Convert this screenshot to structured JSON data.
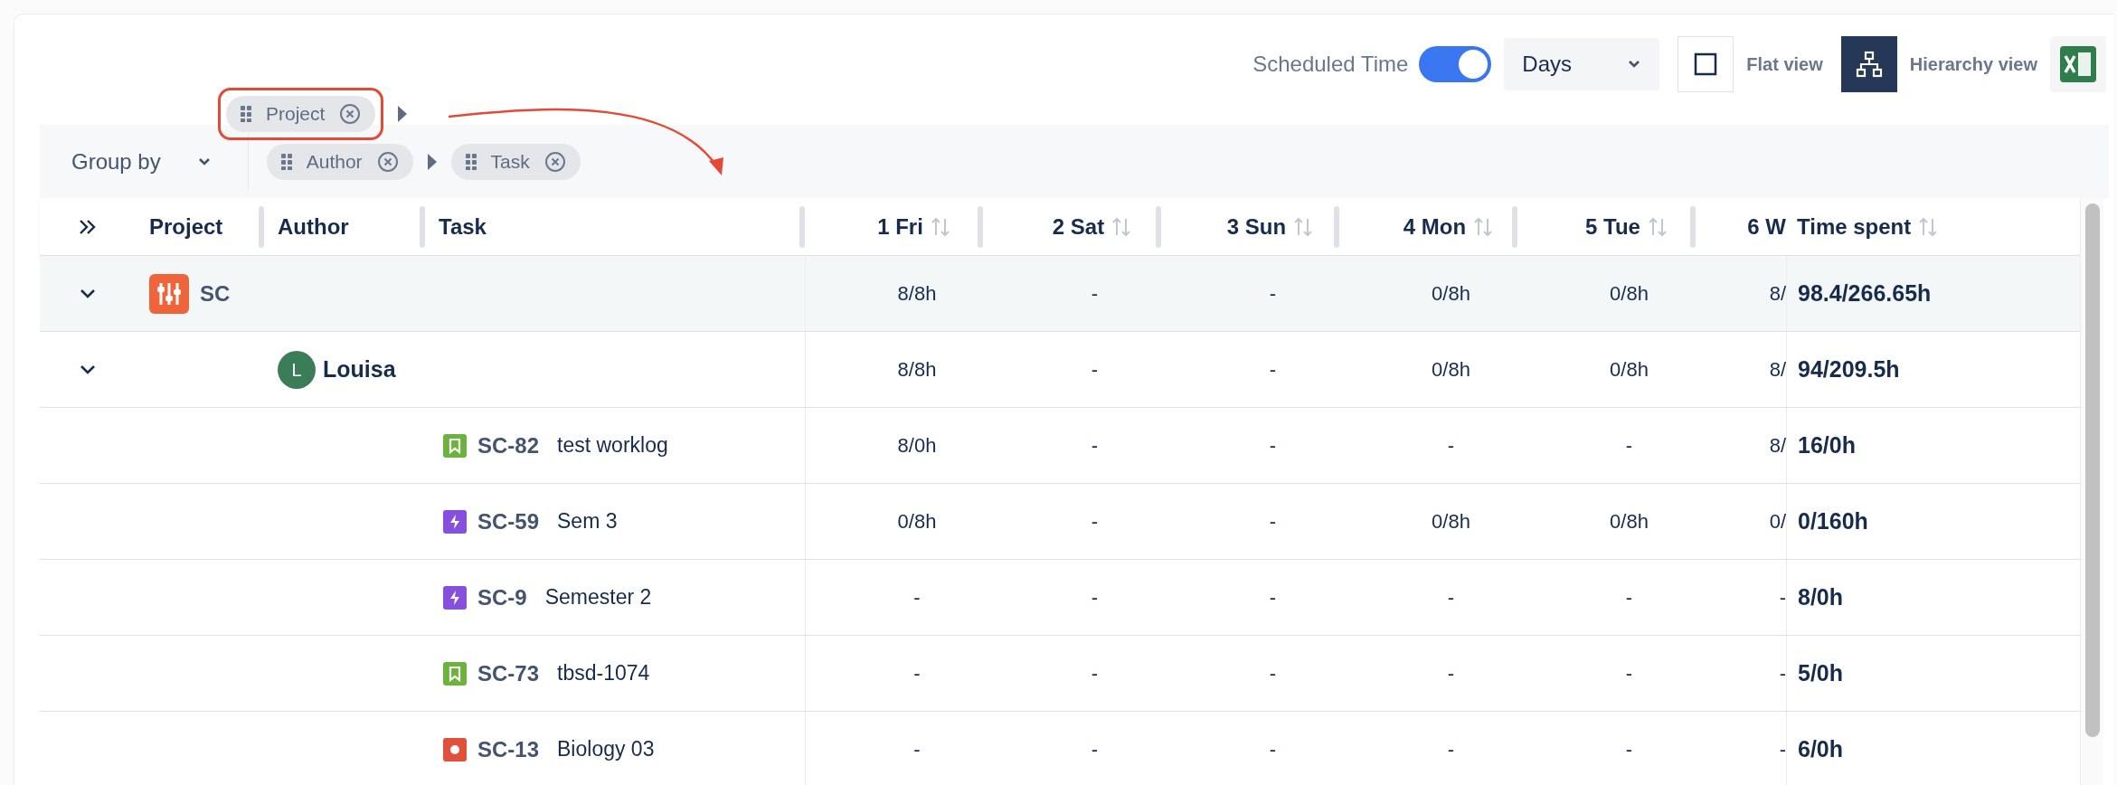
{
  "toolbar": {
    "scheduled_time": {
      "label": "Scheduled Time",
      "on": true
    },
    "period_select": {
      "value": "Days"
    },
    "view_options": [
      {
        "kind": "flat",
        "label": "Flat view",
        "selected": false
      },
      {
        "kind": "hierarchy",
        "label": "Hierarchy view",
        "selected": true
      }
    ]
  },
  "group_by": {
    "label": "Group by",
    "chips": [
      {
        "label": "Author"
      },
      {
        "label": "Task"
      }
    ],
    "dragged_chip": {
      "label": "Project"
    }
  },
  "table": {
    "columns": [
      "Project",
      "Author",
      "Task"
    ],
    "day_columns": [
      "1 Fri",
      "2 Sat",
      "3 Sun",
      "4 Mon",
      "5 Tue",
      "6 W"
    ],
    "total_column": "Time spent",
    "rows": [
      {
        "kind": "project",
        "expanded": true,
        "name": "SC",
        "days": [
          "8/8h",
          "-",
          "-",
          "0/8h",
          "0/8h",
          "8/"
        ],
        "total": "98.4/266.65h"
      },
      {
        "kind": "author",
        "expanded": true,
        "initial": "L",
        "name": "Louisa",
        "days": [
          "8/8h",
          "-",
          "-",
          "0/8h",
          "0/8h",
          "8/"
        ],
        "total": "94/209.5h"
      },
      {
        "kind": "story",
        "key": "SC-82",
        "title": "test worklog",
        "days": [
          "8/0h",
          "-",
          "-",
          "-",
          "-",
          "8/"
        ],
        "total": "16/0h"
      },
      {
        "kind": "epic",
        "key": "SC-59",
        "title": "Sem 3",
        "days": [
          "0/8h",
          "-",
          "-",
          "0/8h",
          "0/8h",
          "0/"
        ],
        "total": "0/160h"
      },
      {
        "kind": "epic",
        "key": "SC-9",
        "title": "Semester 2",
        "days": [
          "-",
          "-",
          "-",
          "-",
          "-",
          "-"
        ],
        "total": "8/0h"
      },
      {
        "kind": "story",
        "key": "SC-73",
        "title": "tbsd-1074",
        "days": [
          "-",
          "-",
          "-",
          "-",
          "-",
          "-"
        ],
        "total": "5/0h"
      },
      {
        "kind": "bug",
        "key": "SC-13",
        "title": "Biology 03",
        "days": [
          "-",
          "-",
          "-",
          "-",
          "-",
          "-"
        ],
        "total": "6/0h"
      }
    ]
  }
}
